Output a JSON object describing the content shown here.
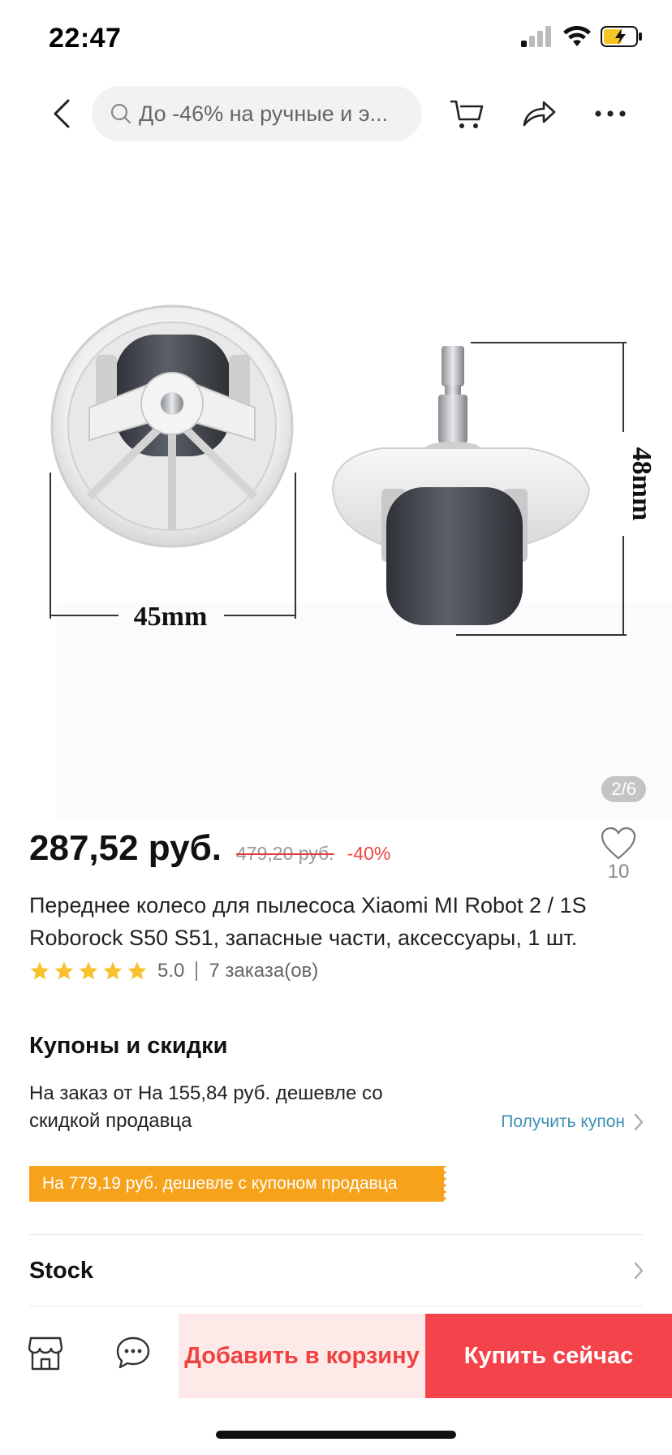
{
  "status_bar": {
    "time": "22:47"
  },
  "nav": {
    "search_placeholder": "До -46% на ручные и э..."
  },
  "gallery": {
    "counter": "2/6",
    "dimension_width": "45mm",
    "dimension_height": "48mm"
  },
  "price": {
    "current": "287,52 руб.",
    "old": "479,20 руб.",
    "discount": "-40%"
  },
  "wishlist": {
    "count": "10"
  },
  "product": {
    "title": "Переднее колесо для пылесоса Xiaomi MI Robot 2 / 1S Roborock S50 S51, запасные части, аксессуары, 1 шт."
  },
  "rating": {
    "stars": 5,
    "value": "5.0",
    "orders": "7 заказа(ов)"
  },
  "coupons": {
    "title": "Купоны и скидки",
    "description": "На заказ от На 155,84 руб. дешевле со скидкой продавца",
    "get_coupon": "Получить купон",
    "banner": "На 779,19 руб. дешевле с купоном продавца"
  },
  "stock": {
    "label": "Stock"
  },
  "bottom_bar": {
    "add_to_cart": "Добавить в корзину",
    "buy_now": "Купить сейчас"
  },
  "colors": {
    "accent_red": "#f5434b",
    "coupon_orange": "#f7a21b",
    "link_blue": "#3e90b4",
    "star_yellow": "#f9c12e"
  }
}
